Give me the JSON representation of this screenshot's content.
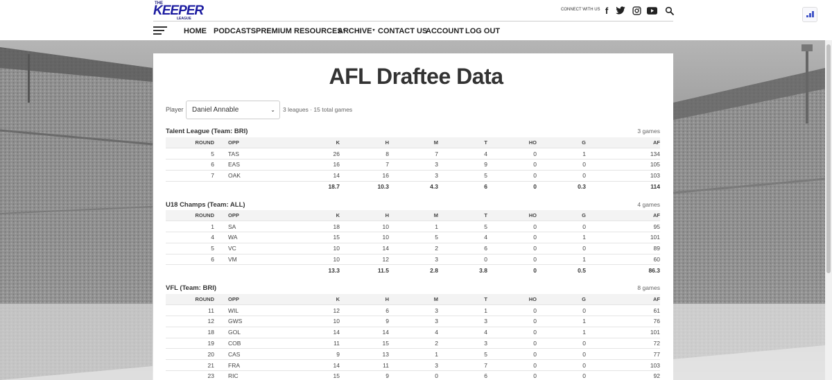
{
  "header": {
    "logo": {
      "the": "THE",
      "main": "KEEPER",
      "league": "LEAGUE"
    },
    "connect_label": "CONNECT WITH US",
    "social_icons": [
      "facebook-icon",
      "twitter-icon",
      "instagram-icon",
      "youtube-icon",
      "search-icon"
    ],
    "nav": [
      {
        "label": "HOME",
        "dropdown": false
      },
      {
        "label": "PODCASTS",
        "dropdown": false
      },
      {
        "label": "PREMIUM RESOURCES",
        "dropdown": true
      },
      {
        "label": "ARCHIVE",
        "dropdown": true
      },
      {
        "label": "CONTACT US",
        "dropdown": false
      },
      {
        "label": "ACCOUNT",
        "dropdown": false
      },
      {
        "label": "LOG OUT",
        "dropdown": false
      }
    ]
  },
  "page": {
    "title": "AFL Draftee Data",
    "player_label": "Player",
    "player_selected": "Daniel Annable",
    "summary": "3 leagues · 15 total games"
  },
  "columns": [
    "ROUND",
    "OPP",
    "K",
    "H",
    "M",
    "T",
    "HO",
    "G",
    "AF"
  ],
  "sections": [
    {
      "title": "Talent League (Team: BRI)",
      "games": "3 games",
      "rows": [
        [
          "5",
          "TAS",
          "26",
          "8",
          "7",
          "4",
          "0",
          "1",
          "134"
        ],
        [
          "6",
          "EAS",
          "16",
          "7",
          "3",
          "9",
          "0",
          "0",
          "105"
        ],
        [
          "7",
          "OAK",
          "14",
          "16",
          "3",
          "5",
          "0",
          "0",
          "103"
        ]
      ],
      "averages": [
        "",
        "",
        "18.7",
        "10.3",
        "4.3",
        "6",
        "0",
        "0.3",
        "114"
      ]
    },
    {
      "title": "U18 Champs (Team: ALL)",
      "games": "4 games",
      "rows": [
        [
          "1",
          "SA",
          "18",
          "10",
          "1",
          "5",
          "0",
          "0",
          "95"
        ],
        [
          "4",
          "WA",
          "15",
          "10",
          "5",
          "4",
          "0",
          "1",
          "101"
        ],
        [
          "5",
          "VC",
          "10",
          "14",
          "2",
          "6",
          "0",
          "0",
          "89"
        ],
        [
          "6",
          "VM",
          "10",
          "12",
          "3",
          "0",
          "0",
          "1",
          "60"
        ]
      ],
      "averages": [
        "",
        "",
        "13.3",
        "11.5",
        "2.8",
        "3.8",
        "0",
        "0.5",
        "86.3"
      ]
    },
    {
      "title": "VFL (Team: BRI)",
      "games": "8 games",
      "rows": [
        [
          "11",
          "WIL",
          "12",
          "6",
          "3",
          "1",
          "0",
          "0",
          "61"
        ],
        [
          "12",
          "GWS",
          "10",
          "9",
          "3",
          "3",
          "0",
          "1",
          "76"
        ],
        [
          "18",
          "GOL",
          "14",
          "14",
          "4",
          "4",
          "0",
          "1",
          "101"
        ],
        [
          "19",
          "COB",
          "11",
          "15",
          "2",
          "3",
          "0",
          "0",
          "72"
        ],
        [
          "20",
          "CAS",
          "9",
          "13",
          "1",
          "5",
          "0",
          "0",
          "77"
        ],
        [
          "21",
          "FRA",
          "14",
          "11",
          "3",
          "7",
          "0",
          "0",
          "103"
        ],
        [
          "23",
          "RIC",
          "15",
          "9",
          "0",
          "6",
          "0",
          "0",
          "92"
        ]
      ],
      "averages": null
    }
  ]
}
